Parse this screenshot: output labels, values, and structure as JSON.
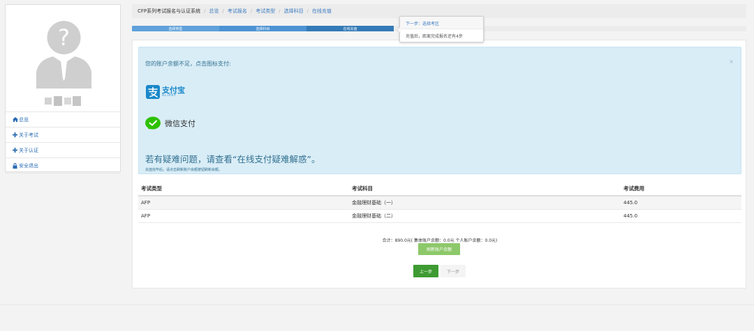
{
  "sidebar": {
    "items": [
      {
        "label": "总览",
        "icon": "home-icon"
      },
      {
        "label": "关于考试",
        "icon": "plus-icon"
      },
      {
        "label": "关于认证",
        "icon": "plus-icon"
      },
      {
        "label": "安全退出",
        "icon": "lock-icon"
      }
    ]
  },
  "breadcrumb": {
    "system": "CFP系列考试报名与认证系统",
    "items": [
      "总览",
      "考试报名",
      "考试类型",
      "选择科目",
      "在线充值"
    ]
  },
  "steps": [
    "选择类型",
    "选择科目",
    "在线充值"
  ],
  "tooltip": {
    "title": "下一步：选择考区",
    "body": "充值后，距离完成报名还有4步"
  },
  "alert": {
    "message": "您的账户余额不足，点击图标支付:",
    "close": "×",
    "alipay_cn": "支付宝",
    "alipay_en": "ALIPAY",
    "wechat": "微信支付",
    "help_prefix": "若有疑难问题，请查看",
    "help_link": "“在线支付疑难解惑”",
    "help_suffix": "。",
    "note": "充值完毕后，请点击刷新账户余额按钮刷新余额。"
  },
  "table": {
    "headers": [
      "考试类型",
      "考试科目",
      "考试费用"
    ],
    "rows": [
      [
        "AFP",
        "金融理财基础（一）",
        "445.0"
      ],
      [
        "AFP",
        "金融理财基础（二）",
        "445.0"
      ]
    ]
  },
  "summary": "合计：890.0元( 集体账户余额：0.0元     个人账户余额：0.0元)",
  "buttons": {
    "refresh": "刷新账户余额",
    "prev": "上一步",
    "next": "下一步"
  },
  "colors": {
    "primary": "#337ab7",
    "alert_bg": "#d9edf7",
    "alipay": "#1a88c9",
    "wechat": "#2dc100",
    "success": "#3e9b32"
  }
}
